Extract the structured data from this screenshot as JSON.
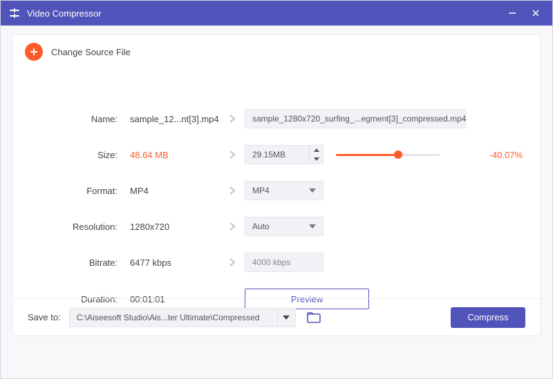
{
  "app": {
    "title": "Video Compressor"
  },
  "source": {
    "change_label": "Change Source File"
  },
  "rows": {
    "name": {
      "label": "Name:",
      "value": "sample_12...nt[3].mp4",
      "output": "sample_1280x720_surfing_...egment[3]_compressed.mp4"
    },
    "size": {
      "label": "Size:",
      "value": "48.64 MB",
      "output": "29.15MB",
      "slider_percent": 60,
      "delta": "-40.07%"
    },
    "format": {
      "label": "Format:",
      "value": "MP4",
      "output": "MP4"
    },
    "resolution": {
      "label": "Resolution:",
      "value": "1280x720",
      "output": "Auto"
    },
    "bitrate": {
      "label": "Bitrate:",
      "value": "6477 kbps",
      "output": "4000 kbps"
    },
    "duration": {
      "label": "Duration:",
      "value": "00:01:01",
      "preview_label": "Preview"
    }
  },
  "footer": {
    "saveto_label": "Save to:",
    "path": "C:\\Aiseesoft Studio\\Ais...ter Ultimate\\Compressed",
    "compress_label": "Compress"
  }
}
